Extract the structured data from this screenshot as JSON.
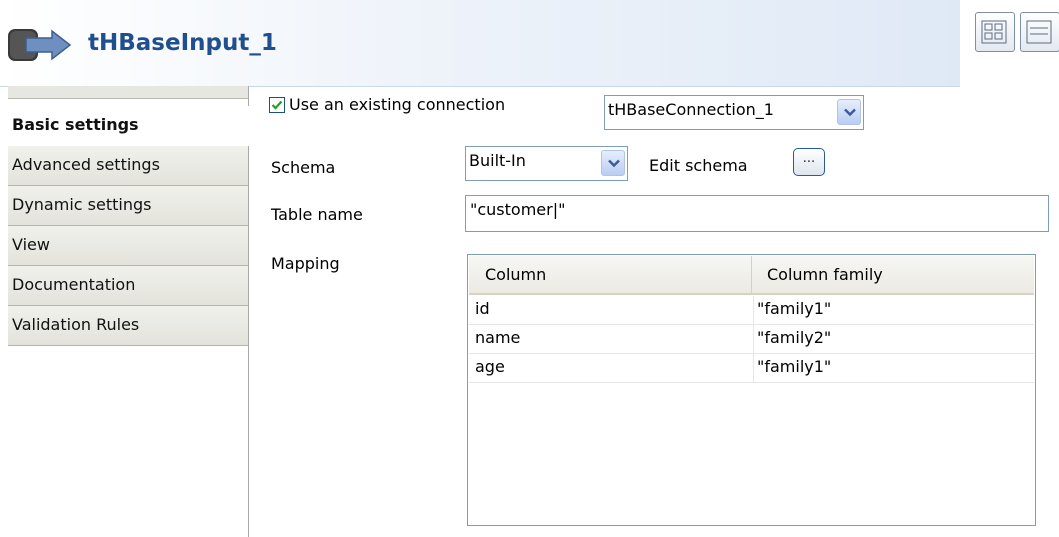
{
  "header": {
    "title": "tHBaseInput_1",
    "accent": "#1f4f8f"
  },
  "tabs": [
    {
      "label": "Basic settings",
      "active": true
    },
    {
      "label": "Advanced settings",
      "active": false
    },
    {
      "label": "Dynamic settings",
      "active": false
    },
    {
      "label": "View",
      "active": false
    },
    {
      "label": "Documentation",
      "active": false
    },
    {
      "label": "Validation Rules",
      "active": false
    }
  ],
  "form": {
    "use_existing_connection": {
      "label": "Use an existing connection",
      "checked": true
    },
    "connection": {
      "value": "tHBaseConnection_1"
    },
    "schema": {
      "label": "Schema",
      "value": "Built-In"
    },
    "edit_schema": {
      "label": "Edit schema",
      "button": "..."
    },
    "table_name": {
      "label": "Table name",
      "value": "\"customer|\""
    },
    "mapping": {
      "label": "Mapping"
    }
  },
  "mapping_table": {
    "columns": [
      "Column",
      "Column family"
    ],
    "rows": [
      [
        "id",
        "\"family1\""
      ],
      [
        "name",
        "\"family2\""
      ],
      [
        "age",
        "\"family1\""
      ]
    ]
  },
  "icons": [
    "component-arrow-icon",
    "layout-grid-icon",
    "layout-list-icon",
    "checkmark-icon",
    "chevron-down-icon"
  ]
}
